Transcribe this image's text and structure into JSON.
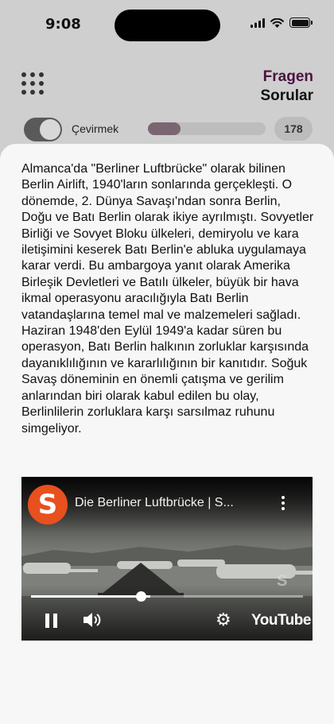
{
  "status_bar": {
    "time": "9:08",
    "icons": [
      "cellular-signal-icon",
      "wifi-icon",
      "battery-icon"
    ]
  },
  "header": {
    "menu_icon": "grid-dots-icon",
    "title_german": "Fragen",
    "title_turkish": "Sorular",
    "colors": {
      "german_title": "#4a1340",
      "turkish_title": "#111111"
    }
  },
  "controls": {
    "translate_toggle_label": "Çevirmek",
    "translate_toggle_on": true,
    "progress_fraction": 0.28,
    "question_count": "178"
  },
  "sheet": {
    "paragraph": "Almanca'da \"Berliner Luftbrücke\" olarak bilinen Berlin Airlift, 1940'ların sonlarında gerçekleşti. O dönemde, 2. Dünya Savaşı'ndan sonra Berlin, Doğu ve Batı Berlin olarak ikiye ayrılmıştı. Sovyetler Birliği ve Sovyet Bloku ülkeleri, demiryolu ve kara iletişimini keserek Batı Berlin'e abluka uygulamaya karar verdi. Bu ambargoya yanıt olarak Amerika Birleşik Devletleri ve Batılı ülkeler, büyük bir hava ikmal operasyonu aracılığıyla Batı Berlin vatandaşlarına temel mal ve malzemeleri sağladı. Haziran 1948'den Eylül 1949'a kadar süren bu operasyon, Batı Berlin halkının zorluklar karşısında dayanıklılığının ve kararlılığının bir kanıtıdır. Soğuk Savaş döneminin en önemli çatışma ve gerilim anlarından biri olarak kabul edilen bu olay, Berlinlilerin zorluklara karşı sarsılmaz ruhunu simgeliyor."
  },
  "video": {
    "channel_logo_letter": "S",
    "title": "Die Berliner Luftbrücke | S...",
    "watermark": "S",
    "progress_fraction": 0.44,
    "brand_label": "YouTube",
    "controls": [
      "pause-icon",
      "volume-icon",
      "settings-icon"
    ],
    "colors": {
      "channel_logo": "#e8501e"
    }
  }
}
